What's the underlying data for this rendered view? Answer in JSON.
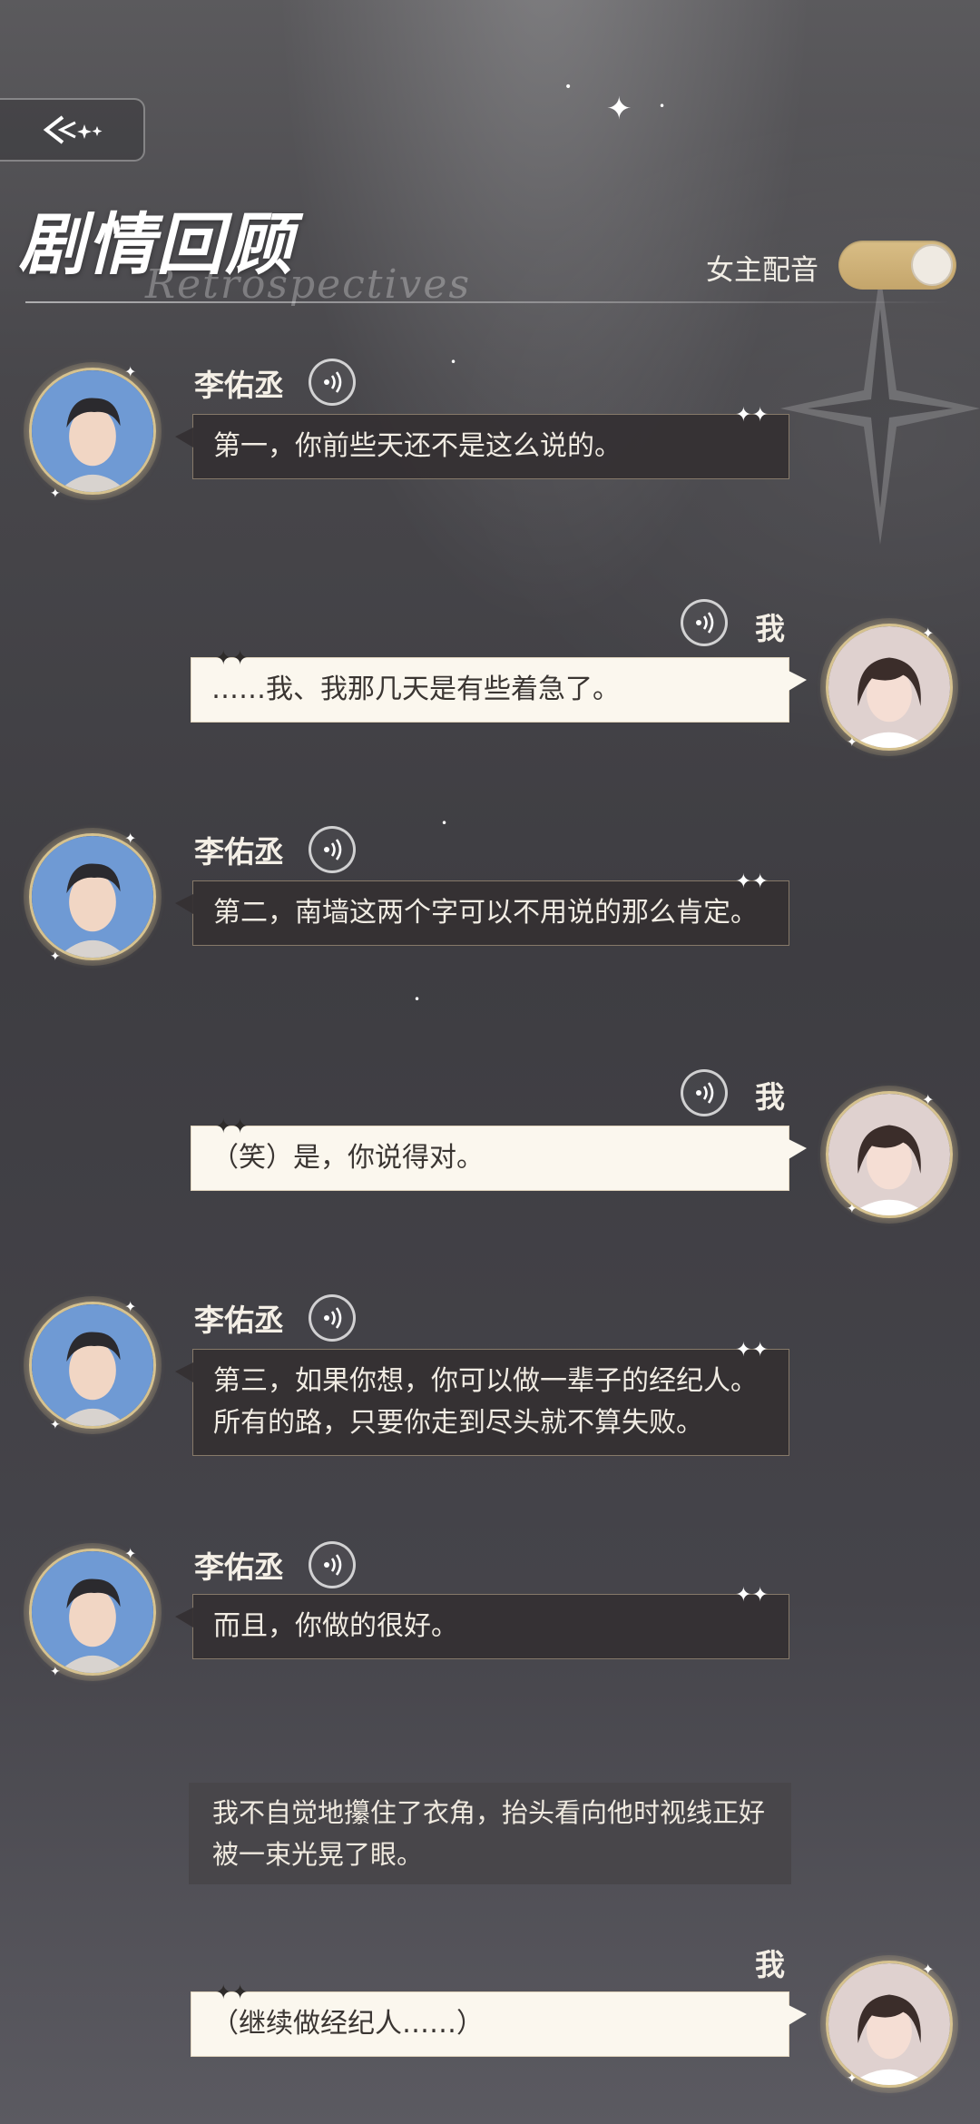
{
  "header": {
    "back_icon": "back-arrow-icon",
    "title": "剧情回顾",
    "title_sub": "Retrospectives",
    "voice_toggle_label": "女主配音",
    "voice_toggle_on": true,
    "toggle_color": "#cfb277"
  },
  "messages": [
    {
      "speaker": "李佑丞",
      "side": "left",
      "text": "第一，你前些天还不是这么说的。"
    },
    {
      "speaker": "我",
      "side": "right",
      "text": "……我、我那几天是有些着急了。"
    },
    {
      "speaker": "李佑丞",
      "side": "left",
      "text": "第二，南墙这两个字可以不用说的那么肯定。"
    },
    {
      "speaker": "我",
      "side": "right",
      "text": "（笑）是，你说得对。"
    },
    {
      "speaker": "李佑丞",
      "side": "left",
      "text": "第三，如果你想，你可以做一辈子的经纪人。所有的路，只要你走到尽头就不算失败。"
    },
    {
      "speaker": "李佑丞",
      "side": "left",
      "text": "而且，你做的很好。"
    },
    {
      "speaker": "我",
      "side": "right",
      "text": "（继续做经纪人……）"
    }
  ],
  "narration": "我不自觉地攥住了衣角，抬头看向他时视线正好被一束光晃了眼。",
  "icons": {
    "voice": "voice-play-icon",
    "sparkle": "sparkle-icon",
    "male_avatar": "li-youcheng-avatar",
    "female_avatar": "heroine-avatar"
  },
  "colors": {
    "accent_gold": "#d6c28f",
    "bubble_dark": "#343032",
    "bubble_light": "#fbf7ee"
  }
}
